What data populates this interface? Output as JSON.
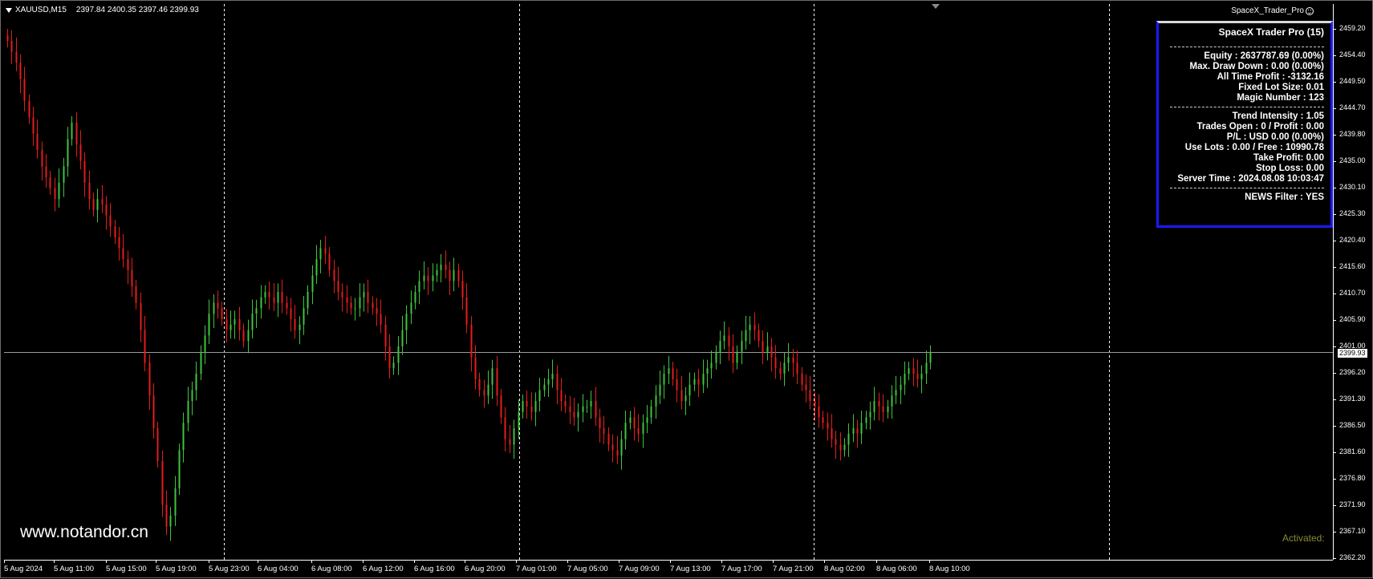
{
  "chart": {
    "symbol": "XAUUSD,M15",
    "ohlc": "2397.84 2400.35 2397.46 2399.93",
    "ea_name": "SpaceX_Trader_Pro",
    "current_price": "2399.93",
    "watermark": "www.notandor.cn",
    "activated_label": "Activated:"
  },
  "colors": {
    "bull": "#3ec43e",
    "bear": "#e31d1d",
    "panel_border": "#1a1aff",
    "background": "#000000",
    "grid_separator": "#ffffff"
  },
  "panel": {
    "title": "SpaceX Trader Pro (15)",
    "block1": [
      "Equity : 2637787.69 (0.00%)",
      "Max. Draw Down : 0.00 (0.00%)",
      "All Time Profit : -3132.16",
      "Fixed Lot Size: 0.01",
      "Magic Number : 123"
    ],
    "block2": [
      "Trend Intensity : 1.05",
      "Trades Open : 0 / Profit : 0.00",
      "P/L : USD 0.00 (0.00%)",
      "Use Lots : 0.00 / Free : 10990.78",
      "Take Profit: 0.00",
      "Stop Loss: 0.00",
      "Server Time : 2024.08.08 10:03:47"
    ],
    "block3": [
      "NEWS Filter : YES"
    ]
  },
  "price_axis": [
    "2459.20",
    "2454.40",
    "2449.50",
    "2444.70",
    "2439.80",
    "2435.00",
    "2430.10",
    "2425.30",
    "2420.40",
    "2415.60",
    "2410.70",
    "2405.90",
    "2401.00",
    "2396.20",
    "2391.30",
    "2386.50",
    "2381.60",
    "2376.80",
    "2371.90",
    "2367.10",
    "2362.20"
  ],
  "time_axis": [
    "5 Aug 2024",
    "5 Aug 11:00",
    "5 Aug 15:00",
    "5 Aug 19:00",
    "5 Aug 23:00",
    "6 Aug 04:00",
    "6 Aug 08:00",
    "6 Aug 12:00",
    "6 Aug 16:00",
    "6 Aug 20:00",
    "7 Aug 01:00",
    "7 Aug 05:00",
    "7 Aug 09:00",
    "7 Aug 13:00",
    "7 Aug 17:00",
    "7 Aug 21:00",
    "8 Aug 02:00",
    "8 Aug 06:00",
    "8 Aug 10:00"
  ],
  "chart_data": {
    "type": "candlestick",
    "y_range": [
      2362.2,
      2459.2
    ],
    "closes": [
      2457,
      2455,
      2453,
      2450,
      2446,
      2443,
      2440,
      2437,
      2434,
      2432,
      2430,
      2428,
      2431,
      2434,
      2439,
      2442,
      2438,
      2435,
      2431,
      2428,
      2426,
      2428,
      2427,
      2425,
      2423,
      2421,
      2419,
      2417,
      2415,
      2412,
      2409,
      2404,
      2398,
      2392,
      2386,
      2380,
      2372,
      2368,
      2370,
      2375,
      2382,
      2387,
      2391,
      2393,
      2396,
      2400,
      2403,
      2407,
      2409,
      2408,
      2406,
      2404,
      2405,
      2406,
      2404,
      2402,
      2404,
      2407,
      2408,
      2410,
      2411,
      2410,
      2409,
      2411,
      2409,
      2408,
      2406,
      2404,
      2405,
      2408,
      2411,
      2414,
      2417,
      2419,
      2418,
      2415,
      2413,
      2411,
      2410,
      2409,
      2408,
      2408,
      2410,
      2411,
      2409,
      2408,
      2407,
      2405,
      2401,
      2397,
      2398,
      2401,
      2404,
      2407,
      2409,
      2411,
      2413,
      2414,
      2413,
      2414,
      2415,
      2416,
      2415,
      2413,
      2415,
      2413,
      2410,
      2405,
      2399,
      2395,
      2393,
      2392,
      2394,
      2397,
      2392,
      2388,
      2384,
      2383,
      2386,
      2389,
      2391,
      2390,
      2389,
      2391,
      2393,
      2394,
      2395,
      2396,
      2393,
      2391,
      2390,
      2389,
      2388,
      2389,
      2390,
      2390,
      2391,
      2388,
      2386,
      2385,
      2383,
      2382,
      2381,
      2384,
      2387,
      2388,
      2386,
      2385,
      2387,
      2388,
      2390,
      2392,
      2394,
      2396,
      2397,
      2395,
      2393,
      2391,
      2392,
      2394,
      2395,
      2394,
      2396,
      2397,
      2398,
      2400,
      2402,
      2403,
      2401,
      2398,
      2400,
      2402,
      2404,
      2405,
      2404,
      2402,
      2400,
      2401,
      2399,
      2397,
      2396,
      2398,
      2399,
      2398,
      2396,
      2394,
      2393,
      2391,
      2390,
      2388,
      2387,
      2386,
      2384,
      2383,
      2382,
      2383,
      2385,
      2386,
      2385,
      2387,
      2388,
      2389,
      2391,
      2390,
      2389,
      2390,
      2392,
      2393,
      2394,
      2396,
      2397,
      2396,
      2395,
      2396,
      2398,
      2400
    ]
  }
}
